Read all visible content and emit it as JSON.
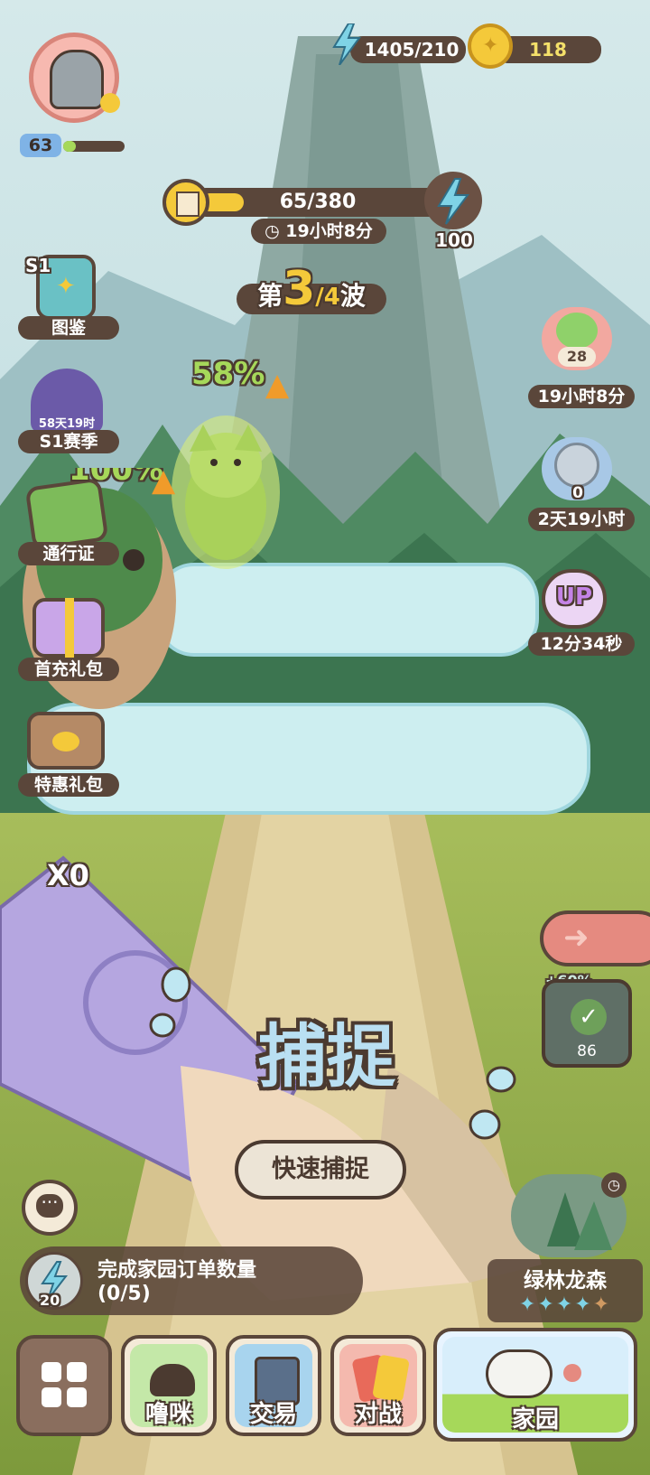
{
  "player": {
    "level": "63"
  },
  "currency": {
    "energy": "1405/210",
    "coins": "118"
  },
  "wave_reward": {
    "progress": "65/380",
    "progress_fraction": 0.17,
    "timer": "19小时8分",
    "energy_reward": "100"
  },
  "wave": {
    "prefix": "第",
    "current": "3",
    "total": "/4",
    "suffix": "波"
  },
  "left_menu": [
    {
      "label": "图鉴",
      "badge": "S1"
    },
    {
      "label": "S1赛季",
      "badge": "58天19时"
    },
    {
      "label": "通行证"
    },
    {
      "label": "首充礼包"
    },
    {
      "label": "特惠礼包"
    }
  ],
  "right_menu": [
    {
      "label": "19小时8分",
      "count": "28"
    },
    {
      "label": "2天19小时",
      "count": "0"
    },
    {
      "label": "12分34秒",
      "badge": "UP"
    }
  ],
  "battle": {
    "pet_bonus_1": "58%",
    "pet_bonus_2": "100%",
    "card_multiplier": "X0",
    "capture_label": "捕捉",
    "quick_capture_label": "快速捕捉",
    "item_bonus": "+60%",
    "item_count": "86"
  },
  "task": {
    "reward": "20",
    "title": "完成家园订单数量",
    "progress": "(0/5)"
  },
  "area": {
    "name": "绿林龙森",
    "stars_filled": 4,
    "stars_total": 5
  },
  "nav": {
    "pet": "噜咪",
    "trade": "交易",
    "battle": "对战",
    "home": "家园"
  },
  "colors": {
    "panel": "#5a463a",
    "accent_gold": "#f4c93a",
    "energy_blue": "#7fd3e6"
  }
}
